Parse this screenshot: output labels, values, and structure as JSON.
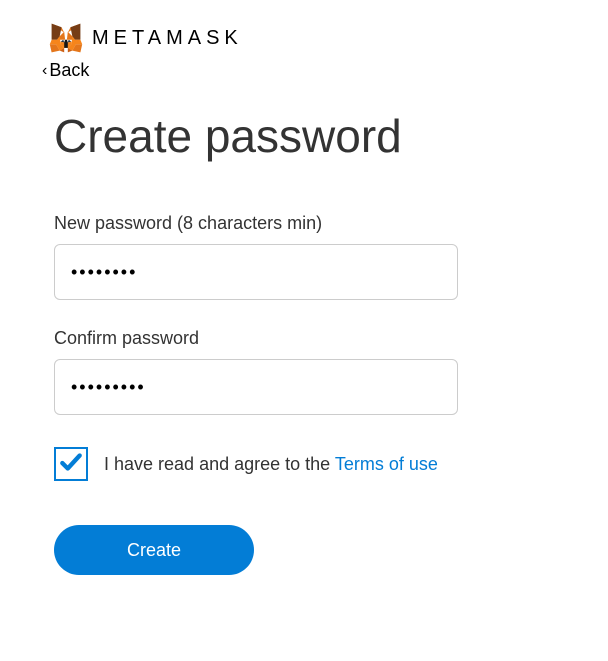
{
  "header": {
    "brand": "METAMASK",
    "back_label": "Back"
  },
  "title": "Create password",
  "fields": {
    "new_password": {
      "label": "New password (8 characters min)",
      "value": "••••••••"
    },
    "confirm_password": {
      "label": "Confirm password",
      "value": "•••••••••"
    }
  },
  "terms": {
    "checked": true,
    "text_prefix": "I have read and agree to the ",
    "link_text": "Terms of use"
  },
  "create_button": "Create"
}
